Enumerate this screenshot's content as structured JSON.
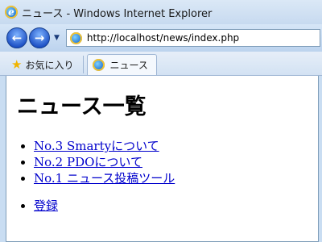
{
  "window": {
    "title": "ニュース - Windows Internet Explorer"
  },
  "toolbar": {
    "back_icon": "back-arrow-icon",
    "forward_icon": "forward-arrow-icon",
    "dropdown_icon": "chevron-down-icon",
    "address": "http://localhost/news/index.php"
  },
  "tabs": {
    "favorites_label": "お気に入り",
    "active_tab_label": "ニュース"
  },
  "page": {
    "heading": "ニュース一覧",
    "news_items": [
      {
        "label": "No.3 Smartyについて"
      },
      {
        "label": "No.2 PDOについて"
      },
      {
        "label": "No.1 ニュース投稿ツール"
      }
    ],
    "register_label": "登録"
  },
  "colors": {
    "link": "#0000cc",
    "chrome": "#c9ddf2"
  }
}
